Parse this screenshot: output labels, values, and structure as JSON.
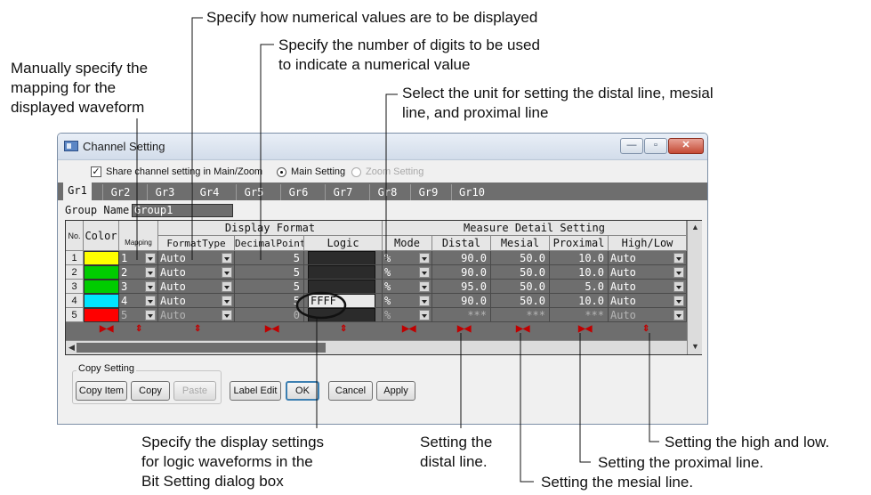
{
  "annotations": {
    "display_format": "Specify how numerical values are to be displayed",
    "digits_1": "Specify the number of digits to be used",
    "digits_2": "to indicate a numerical value",
    "mapping_1": "Manually specify the",
    "mapping_2": "mapping for the",
    "mapping_3": "displayed waveform",
    "unit_1": "Select the unit for setting the distal line, mesial",
    "unit_2": "line, and proximal line",
    "logic_1": "Specify the display settings",
    "logic_2": "for logic waveforms in the",
    "logic_3": "Bit Setting dialog box",
    "distal_1": "Setting the",
    "distal_2": "distal line.",
    "mesial": "Setting the mesial line.",
    "proximal": "Setting the proximal line.",
    "highlow": "Setting the high and low."
  },
  "window": {
    "title": "Channel Setting",
    "min_glyph": "—",
    "max_glyph": "▫",
    "close_glyph": "✕"
  },
  "options": {
    "share_label": "Share channel setting in Main/Zoom",
    "share_checked": "✓",
    "main_label": "Main Setting",
    "zoom_label": "Zoom Setting"
  },
  "tabs": [
    "Gr1",
    "Gr2",
    "Gr3",
    "Gr4",
    "Gr5",
    "Gr6",
    "Gr7",
    "Gr8",
    "Gr9",
    "Gr10"
  ],
  "group_name": {
    "label": "Group Name",
    "value": "Group1"
  },
  "table": {
    "headers": {
      "no": "No.",
      "color": "Color",
      "mapping": "Mapping",
      "display_format": "Display Format",
      "format_type": "FormatType",
      "decimal_point": "DecimalPoint",
      "logic": "Logic",
      "measure_detail": "Measure Detail Setting",
      "mode": "Mode",
      "distal": "Distal",
      "mesial": "Mesial",
      "proximal": "Proximal",
      "high_low": "High/Low"
    },
    "rows": [
      {
        "no": "1",
        "color": "#ffff00",
        "mapping": "1",
        "format": "Auto",
        "decimal": "5",
        "logic": "",
        "mode": "%",
        "distal": "90.0",
        "mesial": "50.0",
        "proximal": "10.0",
        "highlow": "Auto"
      },
      {
        "no": "2",
        "color": "#00cc00",
        "mapping": "2",
        "format": "Auto",
        "decimal": "5",
        "logic": "",
        "mode": "%",
        "distal": "90.0",
        "mesial": "50.0",
        "proximal": "10.0",
        "highlow": "Auto"
      },
      {
        "no": "3",
        "color": "#00cc00",
        "mapping": "3",
        "format": "Auto",
        "decimal": "5",
        "logic": "",
        "mode": "%",
        "distal": "95.0",
        "mesial": "50.0",
        "proximal": "5.0",
        "highlow": "Auto"
      },
      {
        "no": "4",
        "color": "#00e5ff",
        "mapping": "4",
        "format": "Auto",
        "decimal": "5",
        "logic": "FFFF",
        "mode": "%",
        "distal": "90.0",
        "mesial": "50.0",
        "proximal": "10.0",
        "highlow": "Auto"
      },
      {
        "no": "5",
        "color": "#ff0000",
        "mapping": "5",
        "format": "Auto",
        "decimal": "0",
        "logic": "",
        "mode": "%",
        "distal": "***",
        "mesial": "***",
        "proximal": "***",
        "highlow": "Auto"
      }
    ]
  },
  "buttons": {
    "copy_setting": "Copy Setting",
    "copy_item": "Copy Item",
    "copy": "Copy",
    "paste": "Paste",
    "label_edit": "Label Edit",
    "ok": "OK",
    "cancel": "Cancel",
    "apply": "Apply"
  },
  "colors": {
    "accent_focus": "#3c7fb1",
    "grid_bg": "#6e6e6e",
    "highlight_ellipse": "#111111"
  }
}
